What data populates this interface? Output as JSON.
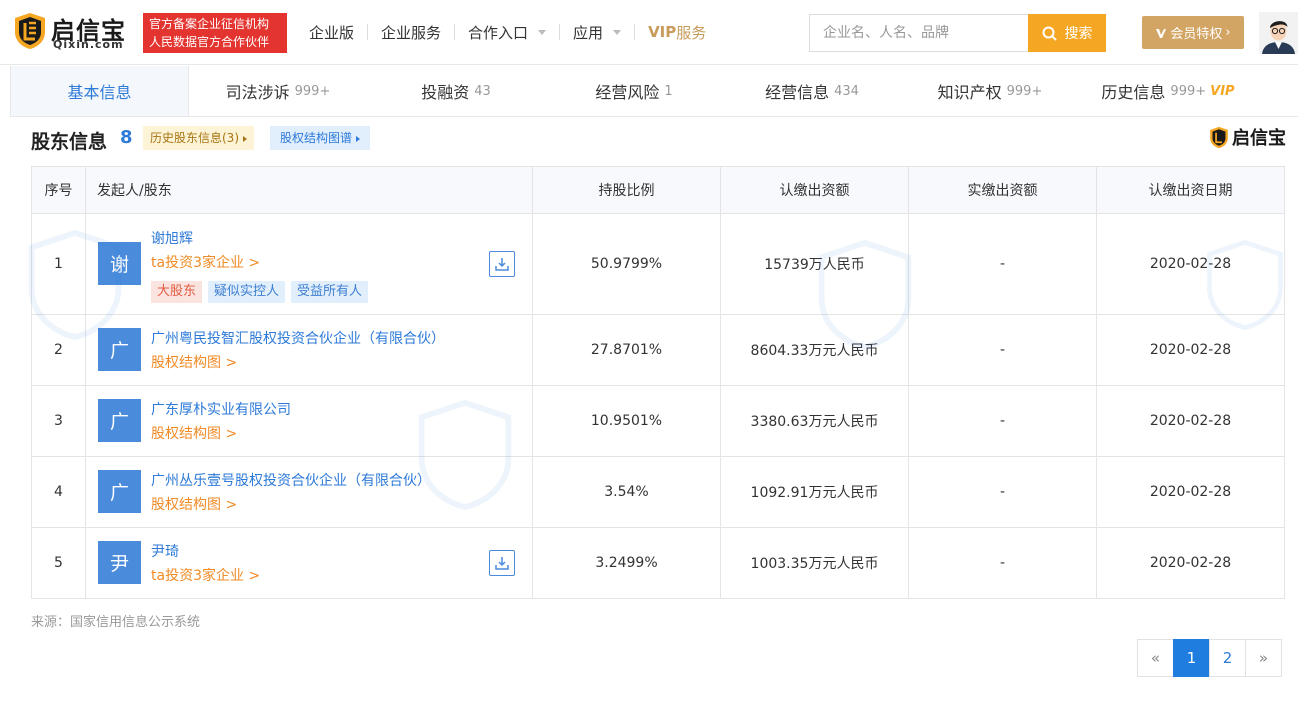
{
  "header": {
    "logo_name": "启信宝",
    "logo_sub": "Qixin.com",
    "badge_line1": "官方备案企业征信机构",
    "badge_line2": "人民数据官方合作伙伴",
    "nav": [
      "企业版",
      "企业服务",
      "合作入口",
      "应用"
    ],
    "vip_prefix": "VIP",
    "vip_suffix": "服务",
    "search_placeholder": "企业名、人名、品牌",
    "search_label": "搜索",
    "member_label": "会员特权"
  },
  "tabs": [
    {
      "label": "基本信息",
      "count": ""
    },
    {
      "label": "司法涉诉",
      "count": "999+"
    },
    {
      "label": "投融资",
      "count": "43"
    },
    {
      "label": "经营风险",
      "count": "1"
    },
    {
      "label": "经营信息",
      "count": "434"
    },
    {
      "label": "知识产权",
      "count": "999+"
    },
    {
      "label": "历史信息",
      "count": "999+",
      "vip": "VIP"
    }
  ],
  "section": {
    "title": "股东信息",
    "count": "8",
    "history_tag": "历史股东信息(3)",
    "map_tag": "股权结构图谱",
    "brand": "启信宝"
  },
  "table": {
    "headers": [
      "序号",
      "发起人/股东",
      "持股比例",
      "认缴出资额",
      "实缴出资额",
      "认缴出资日期"
    ],
    "rows": [
      {
        "no": "1",
        "avatar": "谢",
        "name": "谢旭辉",
        "link": "ta投资3家企业 >",
        "tags": [
          "大股东",
          "疑似实控人",
          "受益所有人"
        ],
        "ratio": "50.9799%",
        "subscribed": "15739万人民币",
        "paid": "-",
        "date": "2020-02-28"
      },
      {
        "no": "2",
        "avatar": "广",
        "name": "广州粤民投智汇股权投资合伙企业（有限合伙）",
        "link": "股权结构图 >",
        "tags": [],
        "ratio": "27.8701%",
        "subscribed": "8604.33万元人民币",
        "paid": "-",
        "date": "2020-02-28"
      },
      {
        "no": "3",
        "avatar": "广",
        "name": "广东厚朴实业有限公司",
        "link": "股权结构图 >",
        "tags": [],
        "ratio": "10.9501%",
        "subscribed": "3380.63万元人民币",
        "paid": "-",
        "date": "2020-02-28"
      },
      {
        "no": "4",
        "avatar": "广",
        "name": "广州丛乐壹号股权投资合伙企业（有限合伙）",
        "link": "股权结构图 >",
        "tags": [],
        "ratio": "3.54%",
        "subscribed": "1092.91万元人民币",
        "paid": "-",
        "date": "2020-02-28"
      },
      {
        "no": "5",
        "avatar": "尹",
        "name": "尹琦",
        "link": "ta投资3家企业 >",
        "tags": [],
        "ratio": "3.2499%",
        "subscribed": "1003.35万元人民币",
        "paid": "-",
        "date": "2020-02-28"
      }
    ]
  },
  "source": "来源：国家信用信息公示系统",
  "pagination": {
    "prev": "«",
    "pages": [
      "1",
      "2"
    ],
    "next": "»",
    "current": "1"
  },
  "colors": {
    "brand_blue": "#2d7ad8",
    "orange": "#f5a623",
    "gold": "#d3a564",
    "red": "#e3342f"
  }
}
